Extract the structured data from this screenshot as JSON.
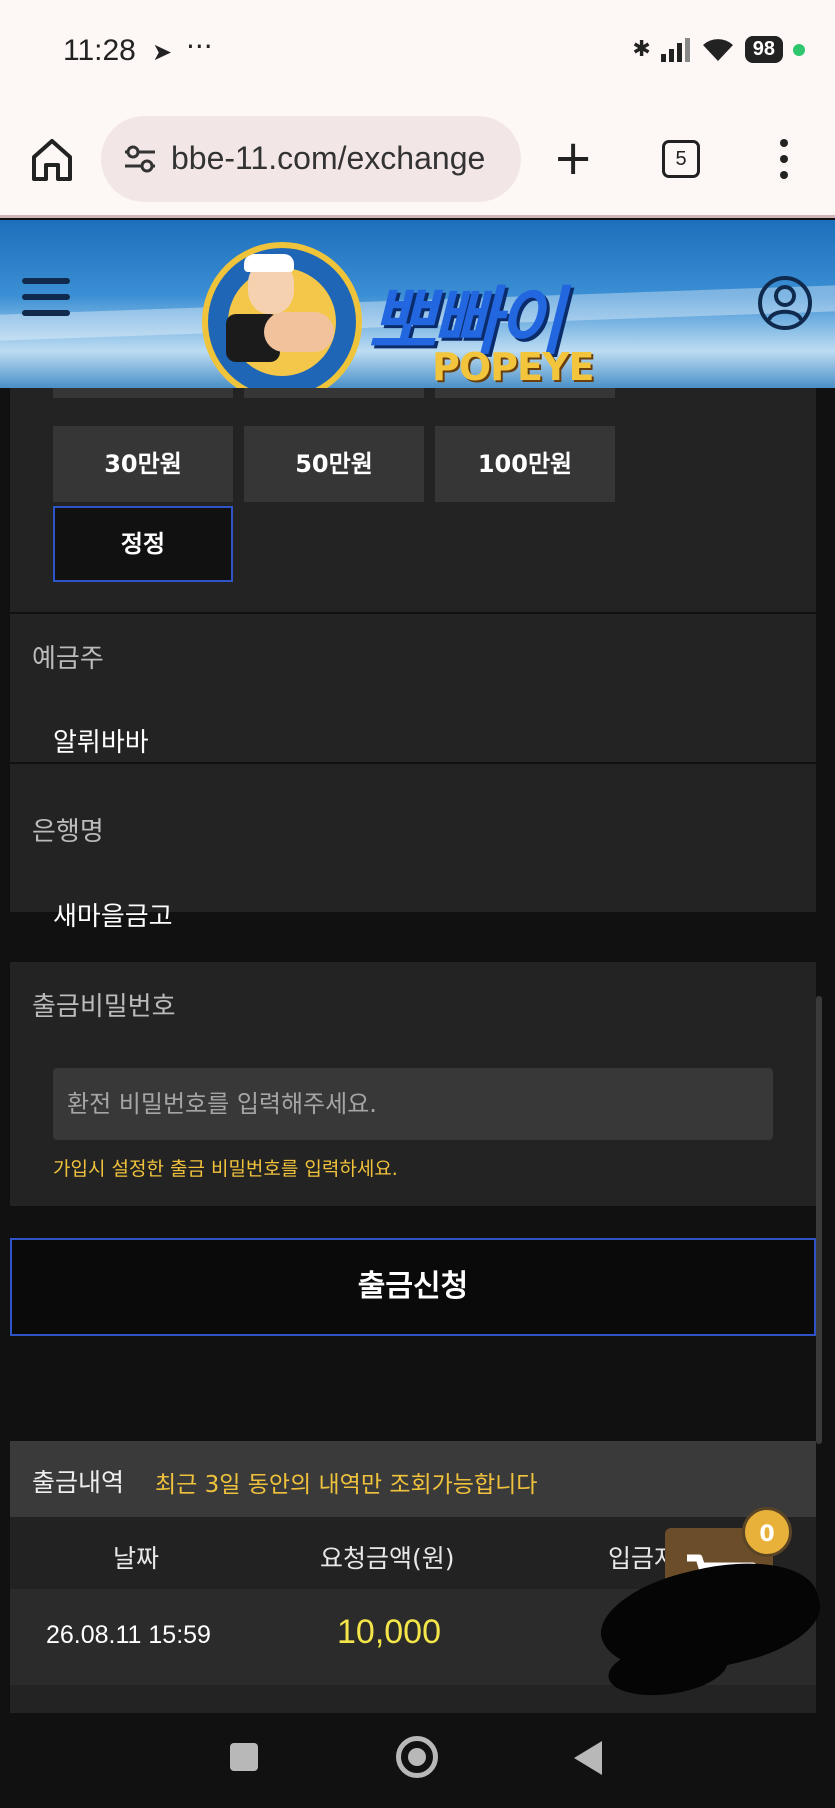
{
  "status_bar": {
    "time": "11:28",
    "telegram_icon": "telegram-icon",
    "more": "···",
    "battery": "98",
    "icons": [
      "bluetooth-icon",
      "signal-icon",
      "wifi-icon"
    ]
  },
  "browser": {
    "url": "bbe-11.com/exchange",
    "tab_count": "5"
  },
  "site": {
    "logo_title": "뽀빠이",
    "logo_sub": "POPEYE"
  },
  "form": {
    "amounts": [
      "30만원",
      "50만원",
      "100만원"
    ],
    "reset_label": "정정",
    "depositor_label": "예금주",
    "depositor_value": "알뤼바바",
    "bank_label": "은행명",
    "bank_value": "새마을금고",
    "password_label": "출금비밀번호",
    "password_placeholder": "환전 비밀번호를 입력해주세요.",
    "password_hint": "가입시 설정한 출금 비밀번호를 입력하세요.",
    "submit_label": "출금신청"
  },
  "history": {
    "title": "출금내역",
    "note": "최근 3일 동안의 내역만 조회가능합니다",
    "columns": [
      "날짜",
      "요청금액(원)",
      "입금자"
    ],
    "rows": [
      {
        "date": "26.08.11 15:59",
        "amount": "10,000"
      }
    ]
  },
  "cart": {
    "count": "0"
  },
  "colors": {
    "accent_border": "#2e55c8",
    "highlight_yellow": "#f0c23c",
    "panel": "#232323"
  }
}
